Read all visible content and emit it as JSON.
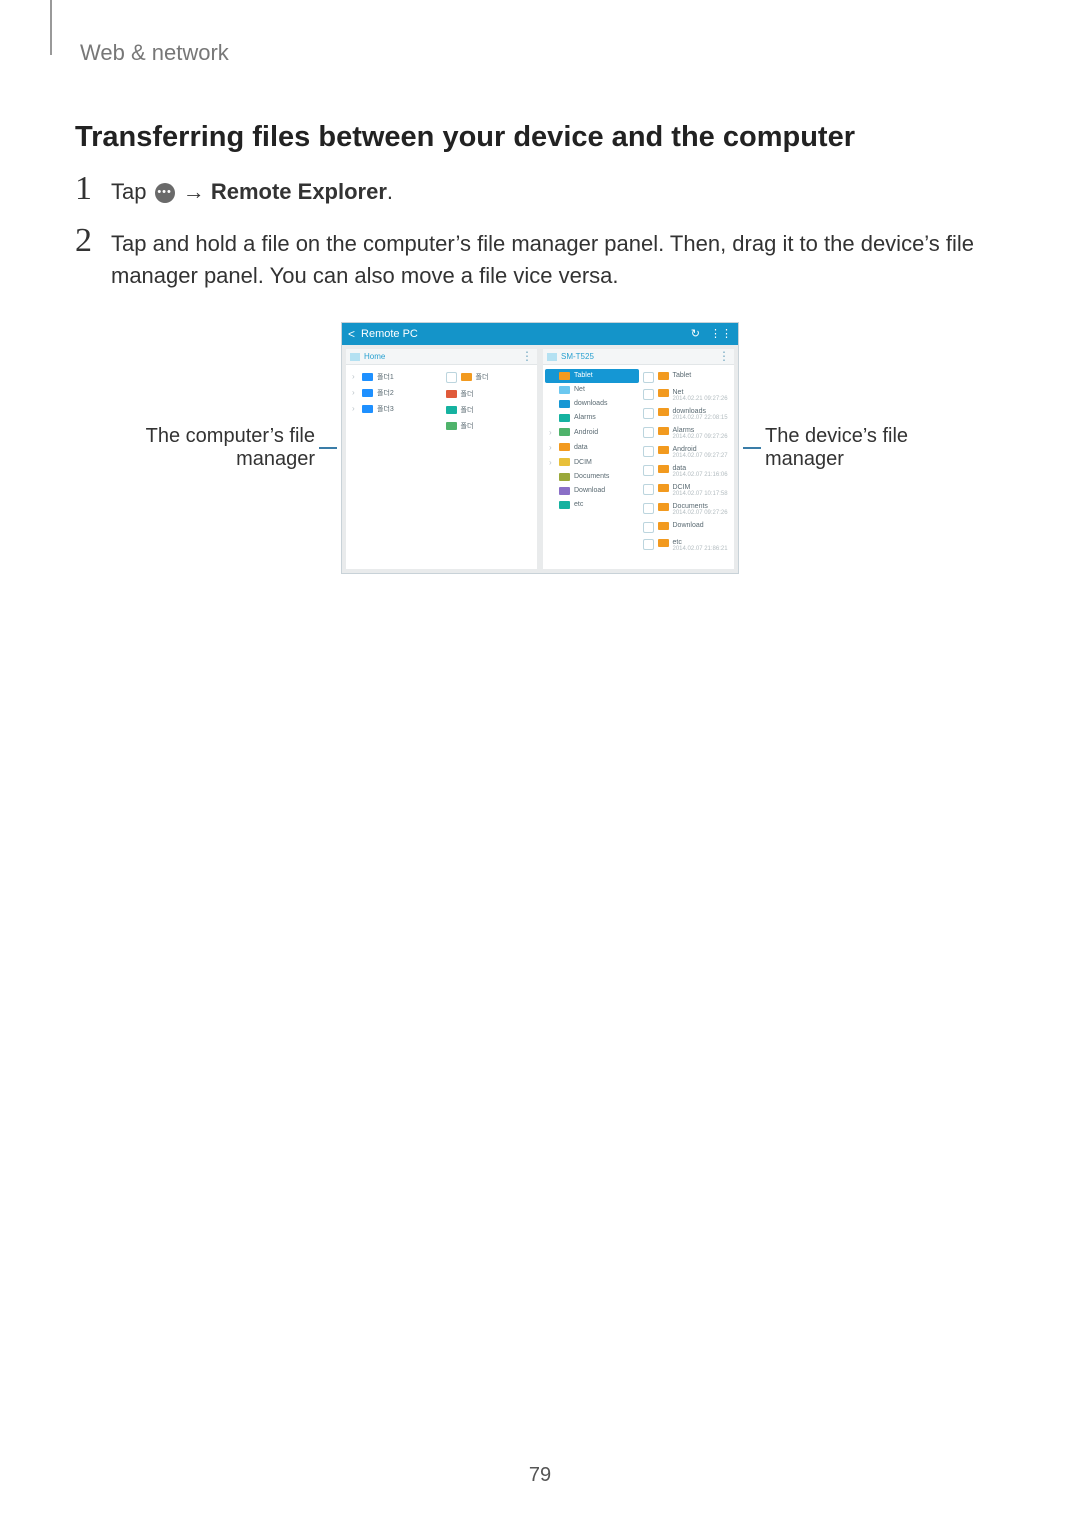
{
  "header": {
    "breadcrumb": "Web & network"
  },
  "section": {
    "title": "Transferring files between your device and the computer"
  },
  "steps": {
    "s1": {
      "num": "1",
      "tap": "Tap ",
      "arrow": " → ",
      "remote_explorer": "Remote Explorer",
      "period": "."
    },
    "s2": {
      "num": "2",
      "text": "Tap and hold a file on the computer’s file manager panel. Then, drag it to the device’s file manager panel. You can also move a file vice versa."
    }
  },
  "callouts": {
    "left_l1": "The computer’s file",
    "left_l2": "manager",
    "right_l1": "The device’s file",
    "right_l2": "manager"
  },
  "screenshot": {
    "titlebar": {
      "back": "Remote PC",
      "refresh_glyph": "↻",
      "grid_glyph": "⋮⋮"
    },
    "left_panel": {
      "header": "Home",
      "rows_l": [
        "폴더1",
        "폴더2",
        "폴더3"
      ],
      "rows_r": [
        "폴더",
        "폴더",
        "폴더",
        "폴더"
      ]
    },
    "right_panel": {
      "header": "SM-T525",
      "rows_l": [
        "Tablet",
        "Net",
        "downloads",
        "Alarms",
        "Android",
        "data",
        "DCIM",
        "Documents",
        "Download",
        "etc"
      ],
      "rows_r": [
        {
          "t": "Tablet",
          "s": ""
        },
        {
          "t": "Net",
          "s": "2014.02.21 09:27:26"
        },
        {
          "t": "downloads",
          "s": "2014.02.07 22:08:15"
        },
        {
          "t": "Alarms",
          "s": "2014.02.07 09:27:26"
        },
        {
          "t": "Android",
          "s": "2014.02.07 09:27:27"
        },
        {
          "t": "data",
          "s": "2014.02.07 21:16:06"
        },
        {
          "t": "DCIM",
          "s": "2014.02.07 10:17:58"
        },
        {
          "t": "Documents",
          "s": "2014.02.07 09:27:26"
        },
        {
          "t": "Download",
          "s": ""
        },
        {
          "t": "etc",
          "s": "2014.02.07 21:86:21"
        }
      ]
    }
  },
  "page_number": "79"
}
